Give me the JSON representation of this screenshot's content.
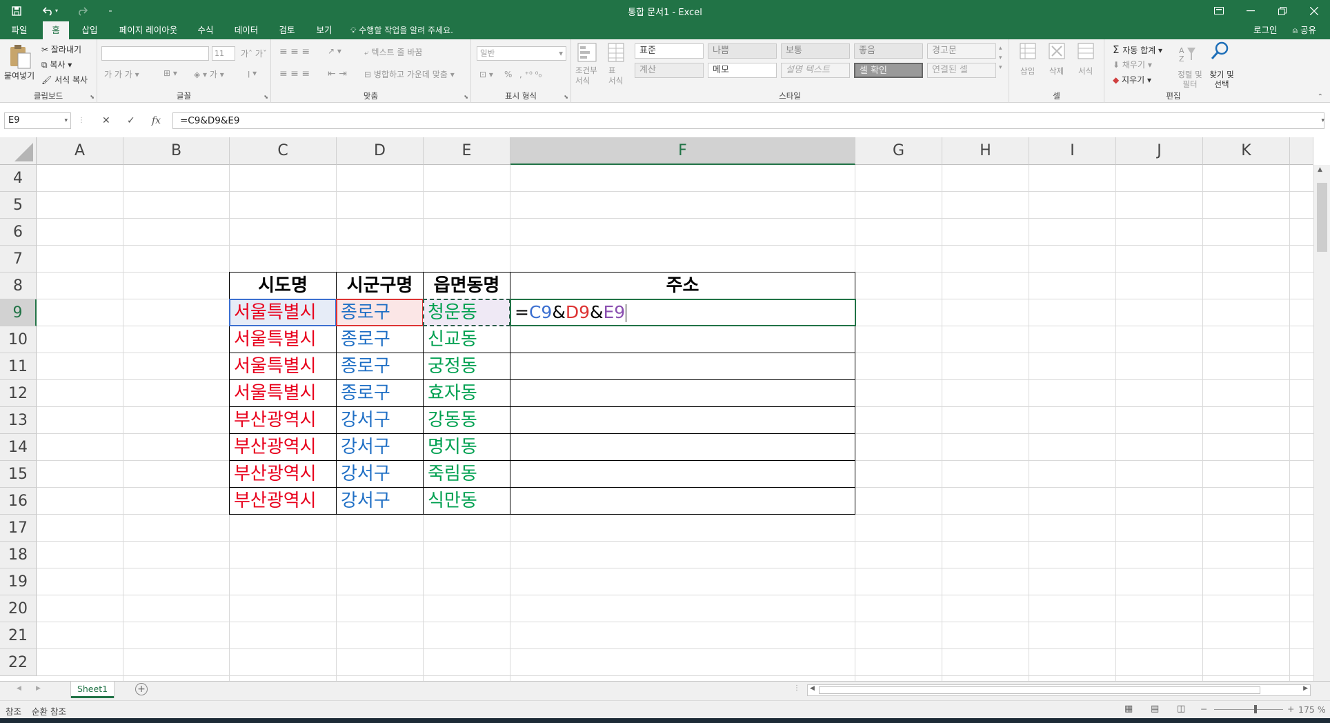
{
  "window": {
    "title": "통합 문서1 - Excel",
    "qat": {
      "save_icon": "save-icon",
      "undo_icon": "undo-icon",
      "redo_icon": "redo-icon",
      "customize_icon": "customize-qat-icon"
    },
    "controls": {
      "ribbon_display": "ribbon-display-icon",
      "minimize": "minimize-icon",
      "restore": "restore-icon",
      "close": "close-icon"
    }
  },
  "tabs": [
    {
      "label": "파일"
    },
    {
      "label": "홈",
      "active": true
    },
    {
      "label": "삽입"
    },
    {
      "label": "페이지 레이아웃"
    },
    {
      "label": "수식"
    },
    {
      "label": "데이터"
    },
    {
      "label": "검토"
    },
    {
      "label": "보기"
    }
  ],
  "tell_me": "수행할 작업을 알려 주세요.",
  "login": "로그인",
  "share": "공유",
  "ribbon": {
    "clipboard": {
      "label": "클립보드",
      "paste": "붙여넣기",
      "cut": "잘라내기",
      "copy": "복사",
      "format_painter": "서식 복사"
    },
    "font": {
      "label": "글꼴",
      "font_size": "11"
    },
    "alignment": {
      "label": "맞춤",
      "wrap_text": "텍스트 줄 바꿈",
      "merge_center": "병합하고 가운데 맞춤"
    },
    "number": {
      "label": "표시 형식",
      "format": "일반",
      "percent": "%"
    },
    "styles": {
      "label": "스타일",
      "conditional_format": "조건부 서식",
      "format_as_table": "표 서식",
      "cells": [
        "표준",
        "나쁨",
        "보통",
        "좋음",
        "경고문",
        "계산",
        "메모",
        "설명 텍스트",
        "셀 확인",
        "연결된 셀"
      ]
    },
    "cells": {
      "label": "셀",
      "insert": "삽입",
      "delete": "삭제",
      "format": "서식"
    },
    "editing": {
      "label": "편집",
      "autosum": "자동 합계",
      "fill": "채우기",
      "clear": "지우기",
      "sort_filter": "정렬 및 필터",
      "find_select": "찾기 및 선택"
    }
  },
  "formula_bar": {
    "name_box": "E9",
    "cancel": "✕",
    "enter": "✓",
    "fx": "fx",
    "formula": "=C9&D9&E9"
  },
  "grid": {
    "columns": [
      "A",
      "B",
      "C",
      "D",
      "E",
      "F",
      "G",
      "H",
      "I",
      "J",
      "K"
    ],
    "selected_column": "F",
    "rows": [
      "4",
      "5",
      "6",
      "7",
      "8",
      "9",
      "10",
      "11",
      "12",
      "13",
      "14",
      "15",
      "16",
      "17",
      "18",
      "19",
      "20",
      "21",
      "22"
    ],
    "selected_row": "9",
    "table": {
      "headers": [
        "시도명",
        "시군구명",
        "읍면동명",
        "주소"
      ],
      "rows": [
        [
          "서울특별시",
          "종로구",
          "청운동"
        ],
        [
          "서울특별시",
          "종로구",
          "신교동"
        ],
        [
          "서울특별시",
          "종로구",
          "궁정동"
        ],
        [
          "서울특별시",
          "종로구",
          "효자동"
        ],
        [
          "부산광역시",
          "강서구",
          "강동동"
        ],
        [
          "부산광역시",
          "강서구",
          "명지동"
        ],
        [
          "부산광역시",
          "강서구",
          "죽림동"
        ],
        [
          "부산광역시",
          "강서구",
          "식만동"
        ]
      ],
      "editing_formula": {
        "eq": "=",
        "c": "C9",
        "amp1": "&",
        "d": "D9",
        "amp2": "&",
        "e": "E9"
      }
    },
    "colors": {
      "sido": "#e8001c",
      "sigungu": "#1f6fc5",
      "eupmyeondong": "#00a050",
      "accent": "#217346"
    }
  },
  "sheet": {
    "name": "Sheet1",
    "add_icon": "add-sheet-icon"
  },
  "status": {
    "left1": "참조",
    "left2": "순환 참조",
    "zoom": "175 %"
  }
}
